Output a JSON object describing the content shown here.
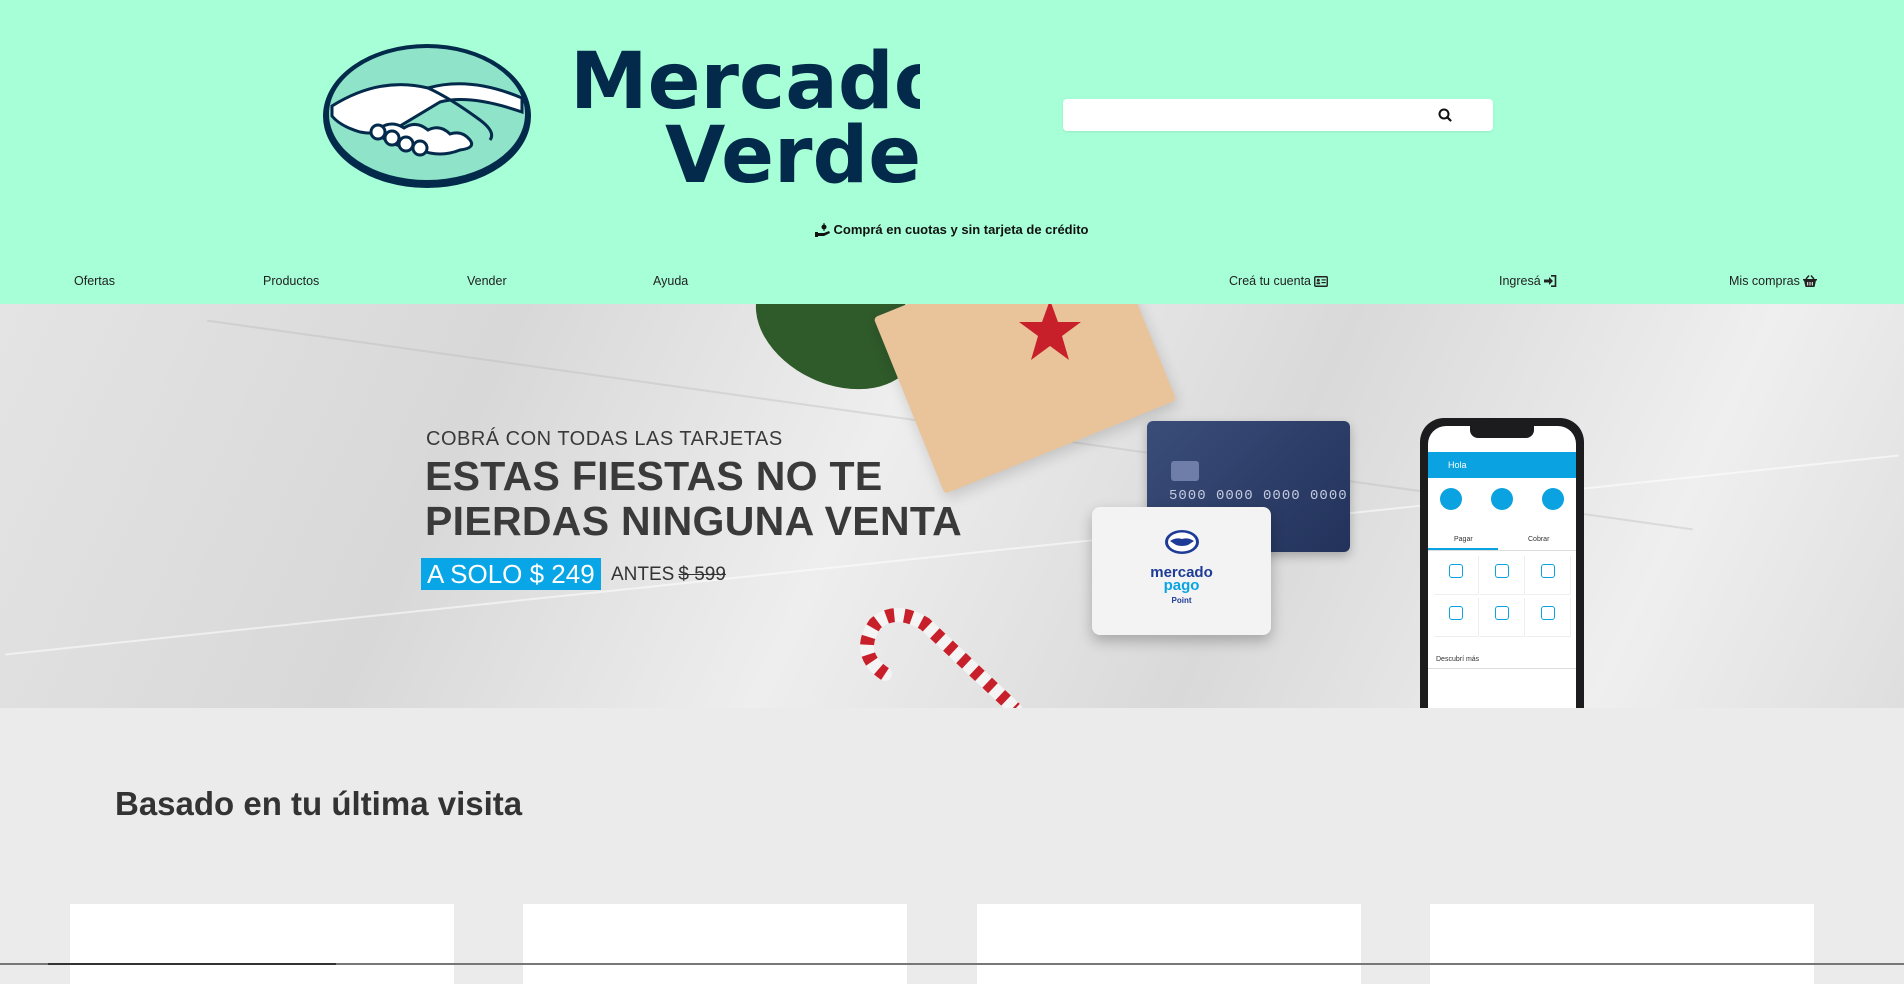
{
  "header": {
    "logo": {
      "line1": "Mercado",
      "line2": "Verde",
      "icon": "handshake-icon",
      "colors": {
        "text": "#032a4b",
        "oval": "#8ee3c9",
        "background": "#a6ffd6"
      }
    },
    "search": {
      "value": "",
      "placeholder": "",
      "icon": "search-icon"
    },
    "promo": {
      "icon": "hand-coin-icon",
      "text": "Comprá en cuotas y sin tarjeta de crédito"
    }
  },
  "nav": {
    "left": [
      "Ofertas",
      "Productos",
      "Vender",
      "Ayuda"
    ],
    "right": [
      {
        "label": "Creá tu cuenta",
        "icon": "id-card-icon"
      },
      {
        "label": "Ingresá",
        "icon": "sign-in-icon"
      },
      {
        "label": "Mis compras",
        "icon": "basket-icon"
      }
    ]
  },
  "banner": {
    "kicker": "COBRÁ CON TODAS LAS TARJETAS",
    "title_line1": "ESTAS FIESTAS NO TE",
    "title_line2": "PIERDAS NINGUNA VENTA",
    "price": "A SOLO $ 249",
    "before_label": "ANTES",
    "before_price": "$ 599",
    "card_number": "5000 0000 0000 0000",
    "device_brand_line1": "mercado",
    "device_brand_line2": "pago",
    "device_model": "Point",
    "phone": {
      "greeting": "Hola",
      "tabs": [
        "Pagar",
        "Cobrar"
      ],
      "footer": "Descubrí más"
    },
    "accent_color": "#08a6e6"
  },
  "section": {
    "title": "Basado en tu última visita"
  }
}
